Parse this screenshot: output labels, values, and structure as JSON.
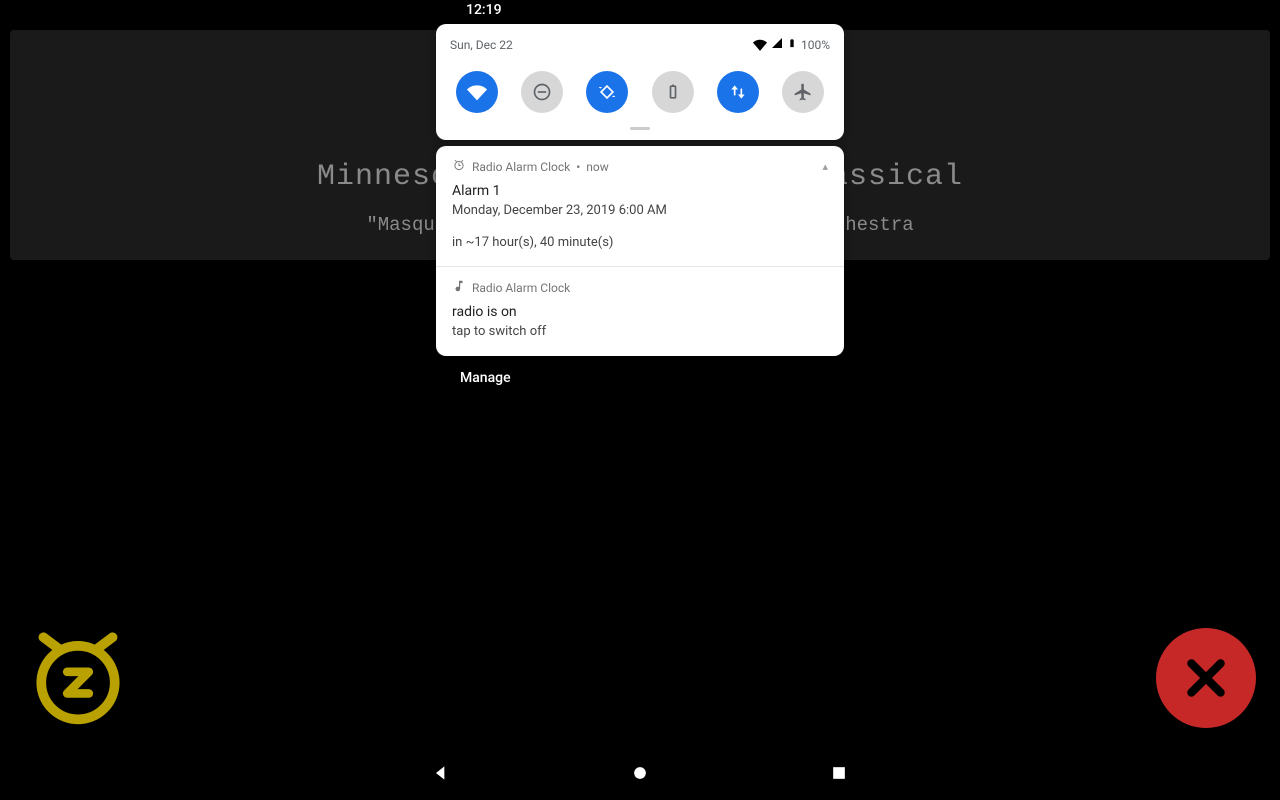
{
  "status": {
    "time": "12:19",
    "date": "Sun, Dec 22",
    "battery": "100%"
  },
  "app": {
    "station": "Minnesota Public Radio — Classical",
    "track": "\"Masquerade: Waltz\" — Spanish National Orchestra"
  },
  "qs": {
    "tiles": [
      {
        "name": "wifi",
        "on": true
      },
      {
        "name": "dnd",
        "on": false
      },
      {
        "name": "auto-rotate",
        "on": true
      },
      {
        "name": "battery-saver",
        "on": false
      },
      {
        "name": "mobile-data",
        "on": true
      },
      {
        "name": "airplane",
        "on": false
      }
    ]
  },
  "notifications": [
    {
      "app": "Radio Alarm Clock",
      "when": "now",
      "icon": "alarm",
      "title": "Alarm 1",
      "line1": "Monday, December 23, 2019 6:00 AM",
      "line2": "in ~17 hour(s), 40 minute(s)",
      "expandable": true
    },
    {
      "app": "Radio Alarm Clock",
      "when": "",
      "icon": "music",
      "title": "radio is on",
      "line1": "tap to switch off",
      "line2": "",
      "expandable": false
    }
  ],
  "manage_label": "Manage"
}
